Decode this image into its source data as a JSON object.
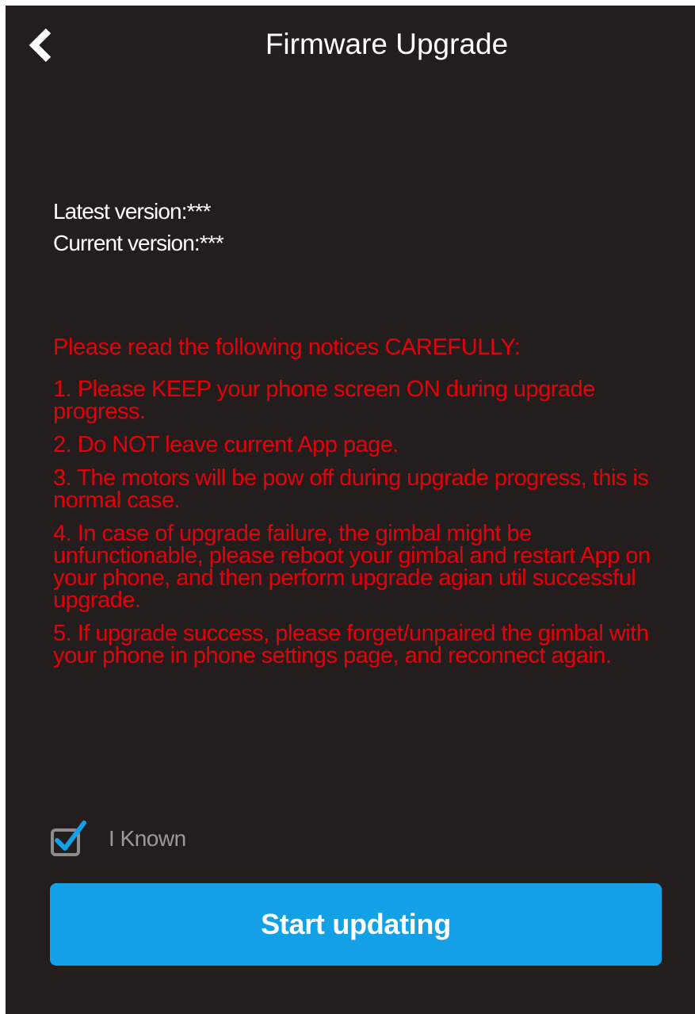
{
  "header": {
    "title": "Firmware Upgrade",
    "back_icon": "chevron-left-icon"
  },
  "versions": {
    "latest": "Latest version:***",
    "current": "Current version:***"
  },
  "notices": {
    "heading": "Please read the following notices CAREFULLY:",
    "items": [
      "1. Please KEEP your phone screen ON during upgrade progress.",
      "2. Do NOT leave current App page.",
      "3. The motors will be pow off during upgrade progress, this is normal case.",
      "4. In case of upgrade failure, the gimbal might be unfunctionable,  please reboot your gimbal and restart App on your phone, and then perform upgrade agian util successful upgrade.",
      "5. If upgrade success, please forget/unpaired the gimbal with your phone in phone settings page, and reconnect again."
    ]
  },
  "acknowledge": {
    "label": "I Known",
    "checked": true,
    "icon": "checkbox-checked-icon"
  },
  "start_button": {
    "label": "Start updating"
  },
  "colors": {
    "background": "#231e1d",
    "notice_text": "#e5000a",
    "button": "#13a0e6",
    "check_accent": "#13a0e6",
    "checkbox_border": "#8c8c8c"
  }
}
